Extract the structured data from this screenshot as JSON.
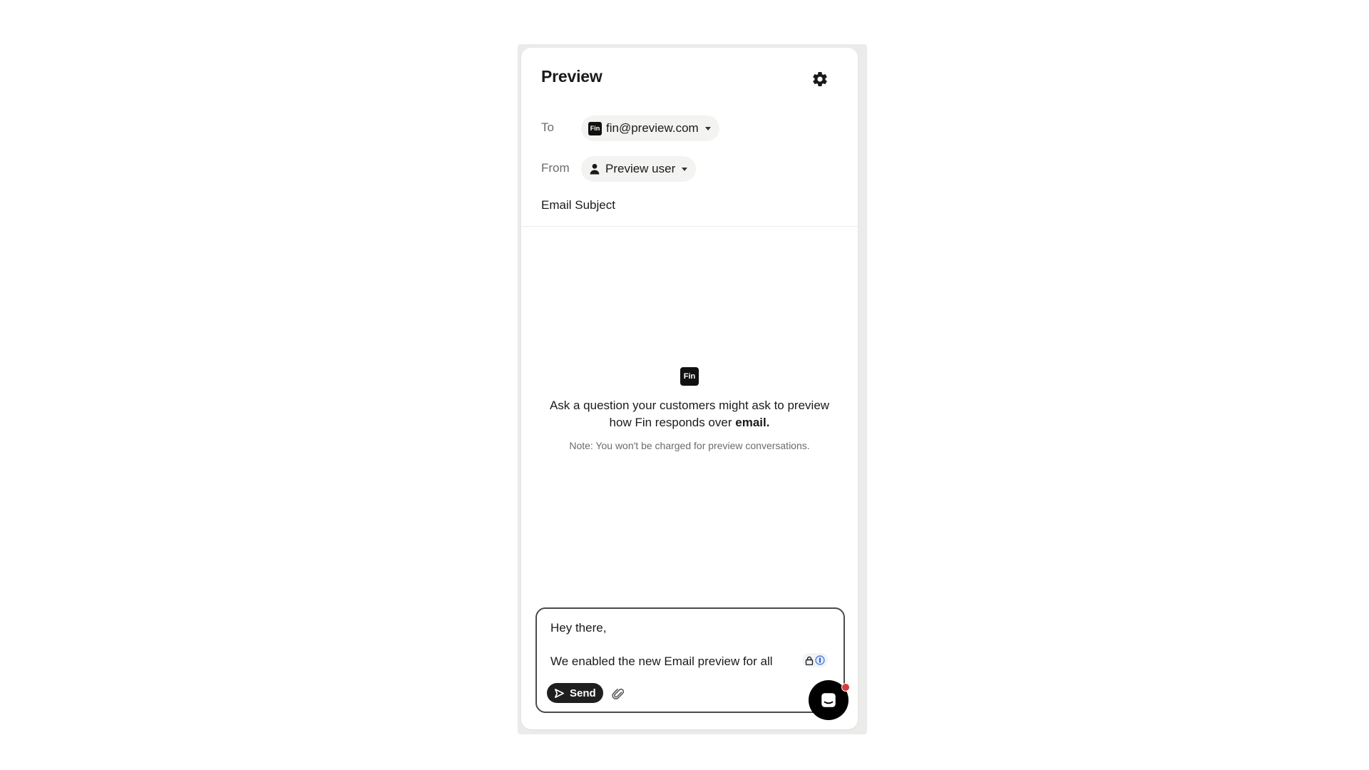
{
  "panel": {
    "title": "Preview"
  },
  "to_row": {
    "label": "To",
    "value": "fin@preview.com",
    "badge": "Fin"
  },
  "from_row": {
    "label": "From",
    "value": "Preview user"
  },
  "subject": {
    "placeholder": "Email Subject"
  },
  "empty_state": {
    "logo": "Fin",
    "prompt_prefix": "Ask a question your customers might ask to preview how Fin responds over",
    "prompt_bold": "email.",
    "note": "Note: You won't be charged for preview conversations."
  },
  "composer": {
    "line1": "Hey there,",
    "line2": "We enabled the new Email preview for all",
    "send_label": "Send"
  },
  "icons": {
    "settings": "gear-icon",
    "person": "person-icon",
    "send": "send-arrow-icon",
    "attach": "paperclip-icon",
    "messenger": "messenger-icon",
    "password_manager": "password-manager-icon"
  },
  "colors": {
    "accent": "#111111",
    "notification": "#d63b3b",
    "frame": "#ebebea"
  }
}
